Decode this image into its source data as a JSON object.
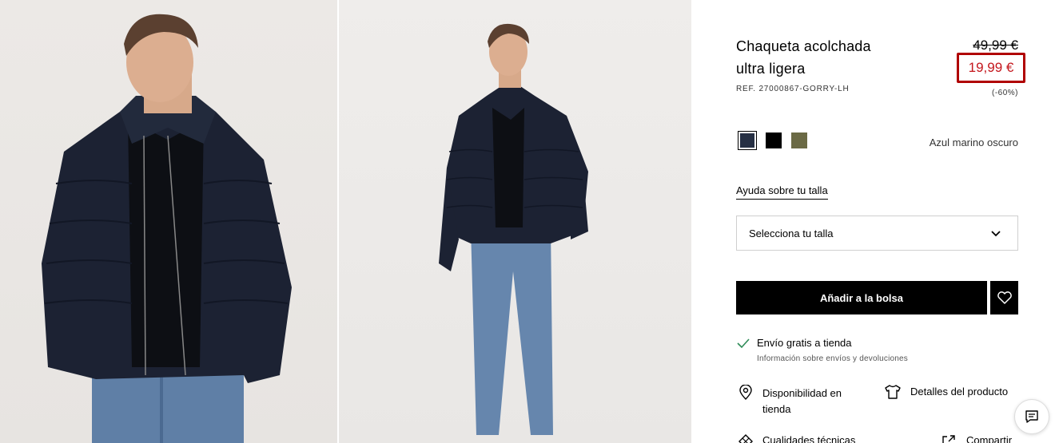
{
  "product": {
    "title_line1": "Chaqueta acolchada",
    "title_line2": "ultra ligera",
    "ref": "REF. 27000867-GORRY-LH",
    "old_price": "49,99 €",
    "new_price": "19,99 €",
    "discount": "(-60%)"
  },
  "colors": {
    "selected_name": "Azul marino oscuro",
    "swatches": [
      {
        "name": "navy",
        "hex": "#263044",
        "selected": true
      },
      {
        "name": "black",
        "hex": "#000000",
        "selected": false
      },
      {
        "name": "khaki",
        "hex": "#6b6a45",
        "selected": false
      }
    ]
  },
  "size": {
    "help_link": "Ayuda sobre tu talla",
    "select_label": "Selecciona tu talla"
  },
  "actions": {
    "add_to_bag": "Añadir a la bolsa"
  },
  "shipping": {
    "title": "Envío gratis a tienda",
    "subtitle": "Información sobre envíos y devoluciones"
  },
  "info_links": {
    "availability": "Disponibilidad en tienda",
    "details": "Detalles del producto",
    "qualities": "Cualidades técnicas",
    "share": "Compartir"
  },
  "theme": {
    "price_red": "#c4161c",
    "highlight_border": "#b00000",
    "check_green": "#2e8b57"
  }
}
